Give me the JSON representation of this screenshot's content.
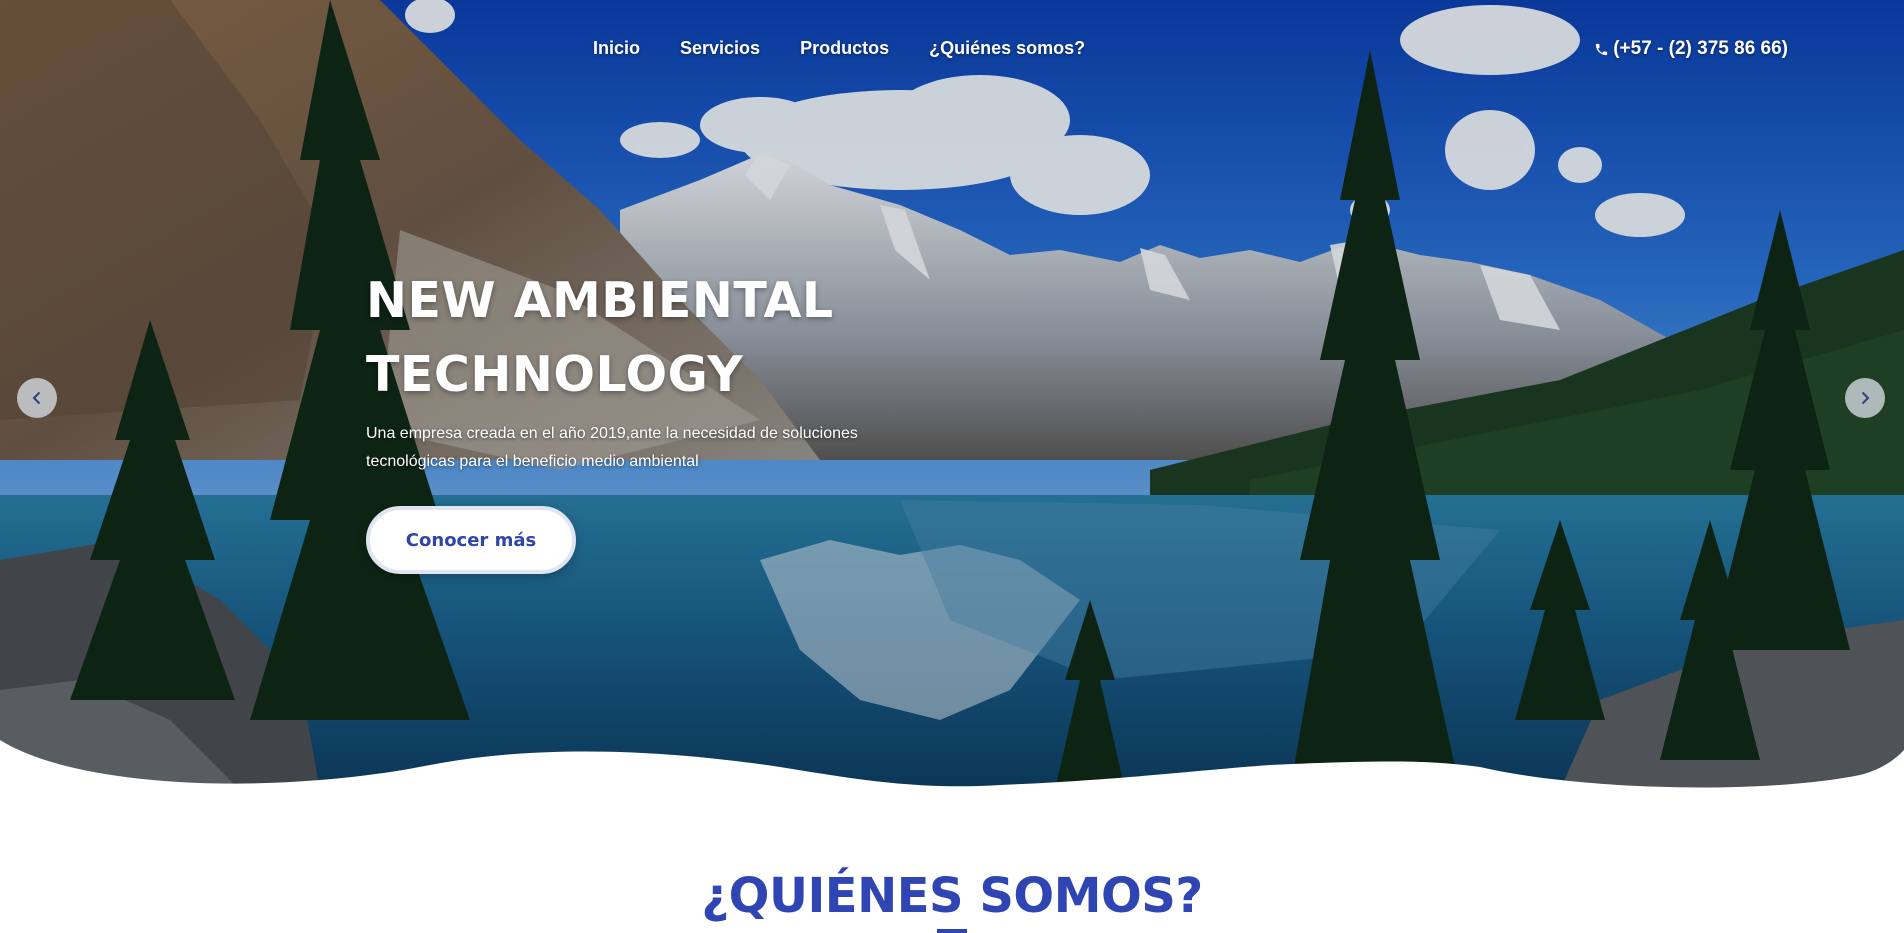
{
  "nav": {
    "items": [
      {
        "label": "Inicio"
      },
      {
        "label": "Servicios"
      },
      {
        "label": "Productos"
      },
      {
        "label": "¿Quiénes somos?"
      }
    ],
    "phone": "(+57 - (2) 375 86 66)",
    "phone_icon": "phone-icon"
  },
  "hero": {
    "title_line1": "NEW AMBIENTAL",
    "title_line2": "TECHNOLOGY",
    "description": "Una empresa creada en el año 2019,ante la necesidad de soluciones tecnológicas para el beneficio medio ambiental",
    "cta_label": "Conocer más",
    "prev_icon": "chevron-left-icon",
    "next_icon": "chevron-right-icon"
  },
  "section": {
    "title": "¿QUIÉNES SOMOS?"
  },
  "colors": {
    "accent": "#2f45b3",
    "white": "#ffffff"
  }
}
